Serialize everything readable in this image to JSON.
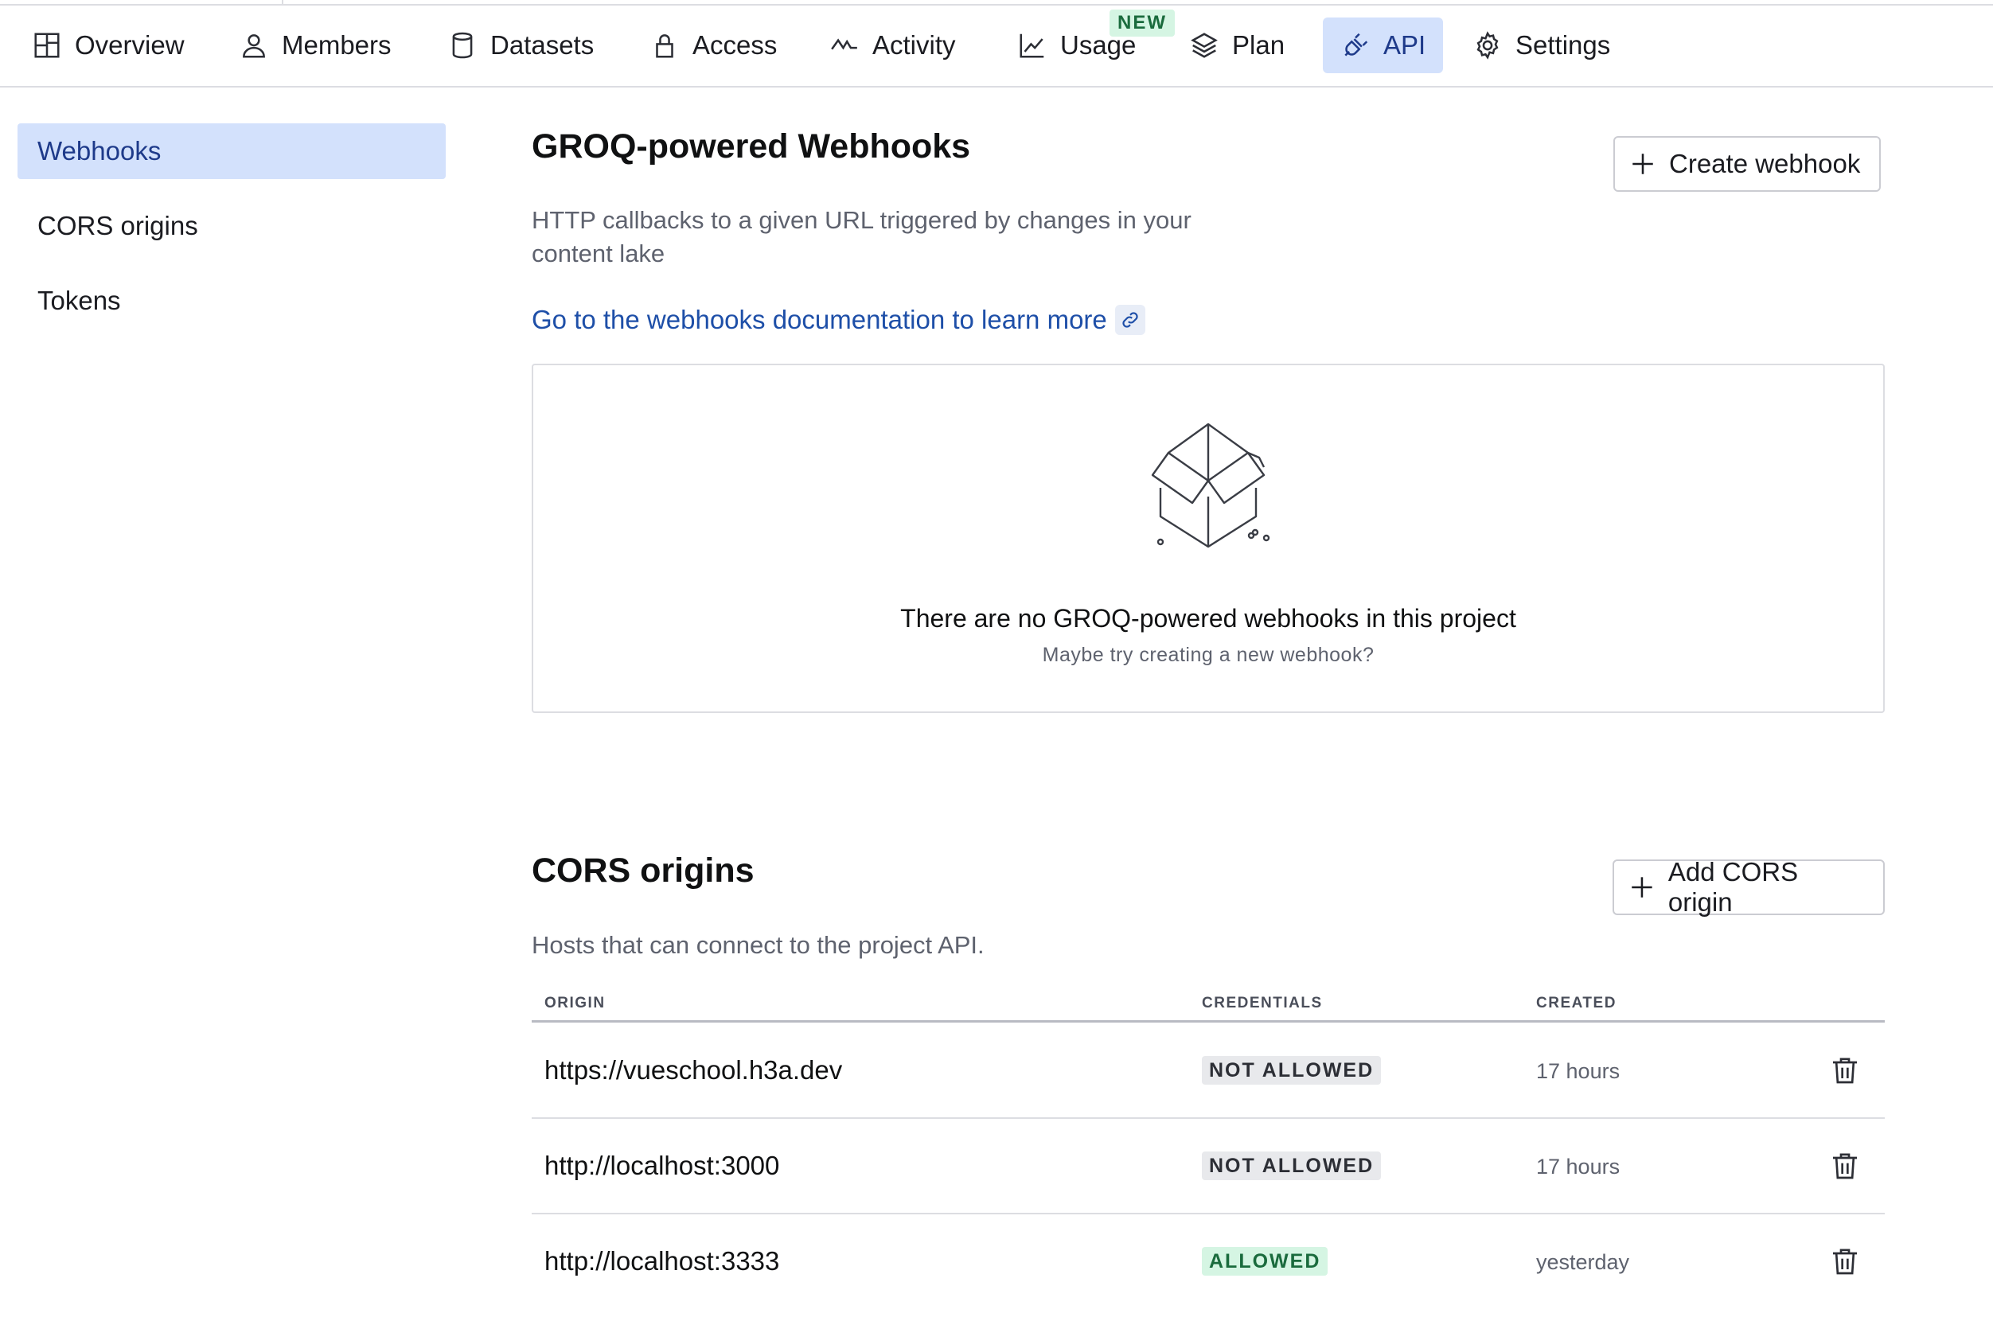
{
  "nav": {
    "items": [
      {
        "label": "Overview",
        "icon": "overview-icon"
      },
      {
        "label": "Members",
        "icon": "members-icon"
      },
      {
        "label": "Datasets",
        "icon": "datasets-icon"
      },
      {
        "label": "Access",
        "icon": "lock-icon"
      },
      {
        "label": "Activity",
        "icon": "activity-icon"
      },
      {
        "label": "Usage",
        "icon": "chart-icon"
      },
      {
        "label": "Plan",
        "icon": "layers-icon"
      },
      {
        "label": "API",
        "icon": "plug-icon",
        "active": true
      },
      {
        "label": "Settings",
        "icon": "gear-icon"
      }
    ],
    "new_badge": "NEW"
  },
  "sidebar": {
    "items": [
      {
        "label": "Webhooks",
        "active": true
      },
      {
        "label": "CORS origins"
      },
      {
        "label": "Tokens"
      }
    ]
  },
  "webhooks": {
    "title": "GROQ-powered Webhooks",
    "description_line1": "HTTP callbacks to a given URL triggered by changes in your",
    "description_line2": "content lake",
    "create_button": "Create webhook",
    "doc_link": "Go to the webhooks documentation to learn more",
    "empty_title": "There are no GROQ-powered webhooks in this project",
    "empty_subtitle": "Maybe try creating a new webhook?"
  },
  "cors": {
    "title": "CORS origins",
    "description": "Hosts that can connect to the project API.",
    "add_button": "Add CORS origin",
    "columns": {
      "origin": "ORIGIN",
      "credentials": "CREDENTIALS",
      "created": "CREATED"
    },
    "rows": [
      {
        "origin": "https://vueschool.h3a.dev",
        "credentials": "NOT ALLOWED",
        "created": "17 hours"
      },
      {
        "origin": "http://localhost:3000",
        "credentials": "NOT ALLOWED",
        "created": "17 hours"
      },
      {
        "origin": "http://localhost:3333",
        "credentials": "ALLOWED",
        "created": "yesterday"
      }
    ]
  },
  "colors": {
    "accent_bg": "#d3e1fc",
    "accent_text": "#1e3a8a",
    "link": "#1e4fa8",
    "allowed_bg": "#d5f5e3",
    "allowed_text": "#1a6b3d",
    "not_allowed_bg": "#e8e9ec"
  }
}
